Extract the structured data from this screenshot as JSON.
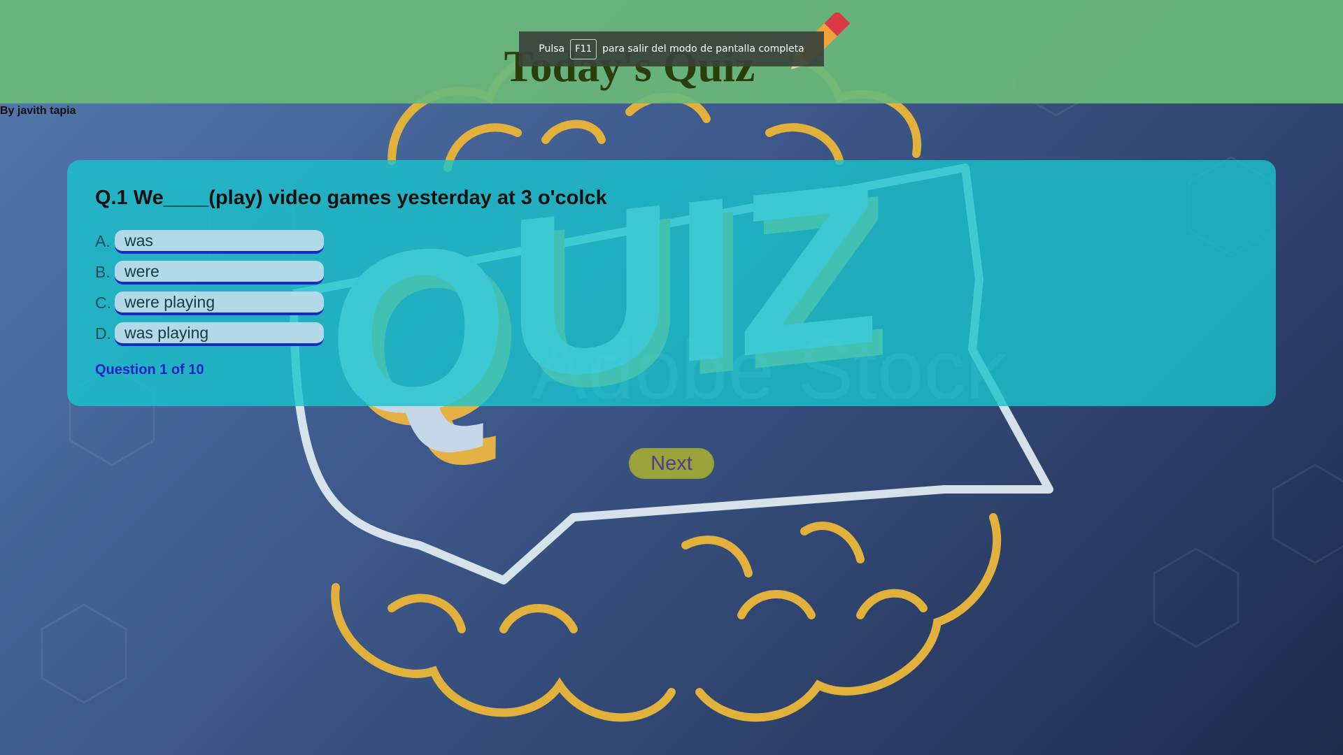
{
  "header": {
    "title": "Today's Quiz",
    "author": "By javith tapia"
  },
  "fullscreen_notice": {
    "prefix": "Pulsa",
    "key": "F11",
    "suffix": "para salir del modo de pantalla completa"
  },
  "background": {
    "watermark": "Adobe Stock",
    "logo_text": "QUIZ"
  },
  "quiz": {
    "question": "Q.1 We____(play) video games yesterday at 3 o'colck",
    "options": [
      {
        "letter": "A.",
        "text": "was"
      },
      {
        "letter": "B.",
        "text": "were"
      },
      {
        "letter": "C.",
        "text": "were playing"
      },
      {
        "letter": "D.",
        "text": "was playing"
      }
    ],
    "progress": "Question 1 of 10",
    "next_label": "Next"
  },
  "colors": {
    "header": "#6ab87a",
    "card": "#19c4cd",
    "next_button": "#9aa23a",
    "title": "#2b3d0c",
    "progress": "#1f22c8"
  },
  "icons": [
    "pencil-icon",
    "brain-icon",
    "speech-bubble-icon"
  ]
}
